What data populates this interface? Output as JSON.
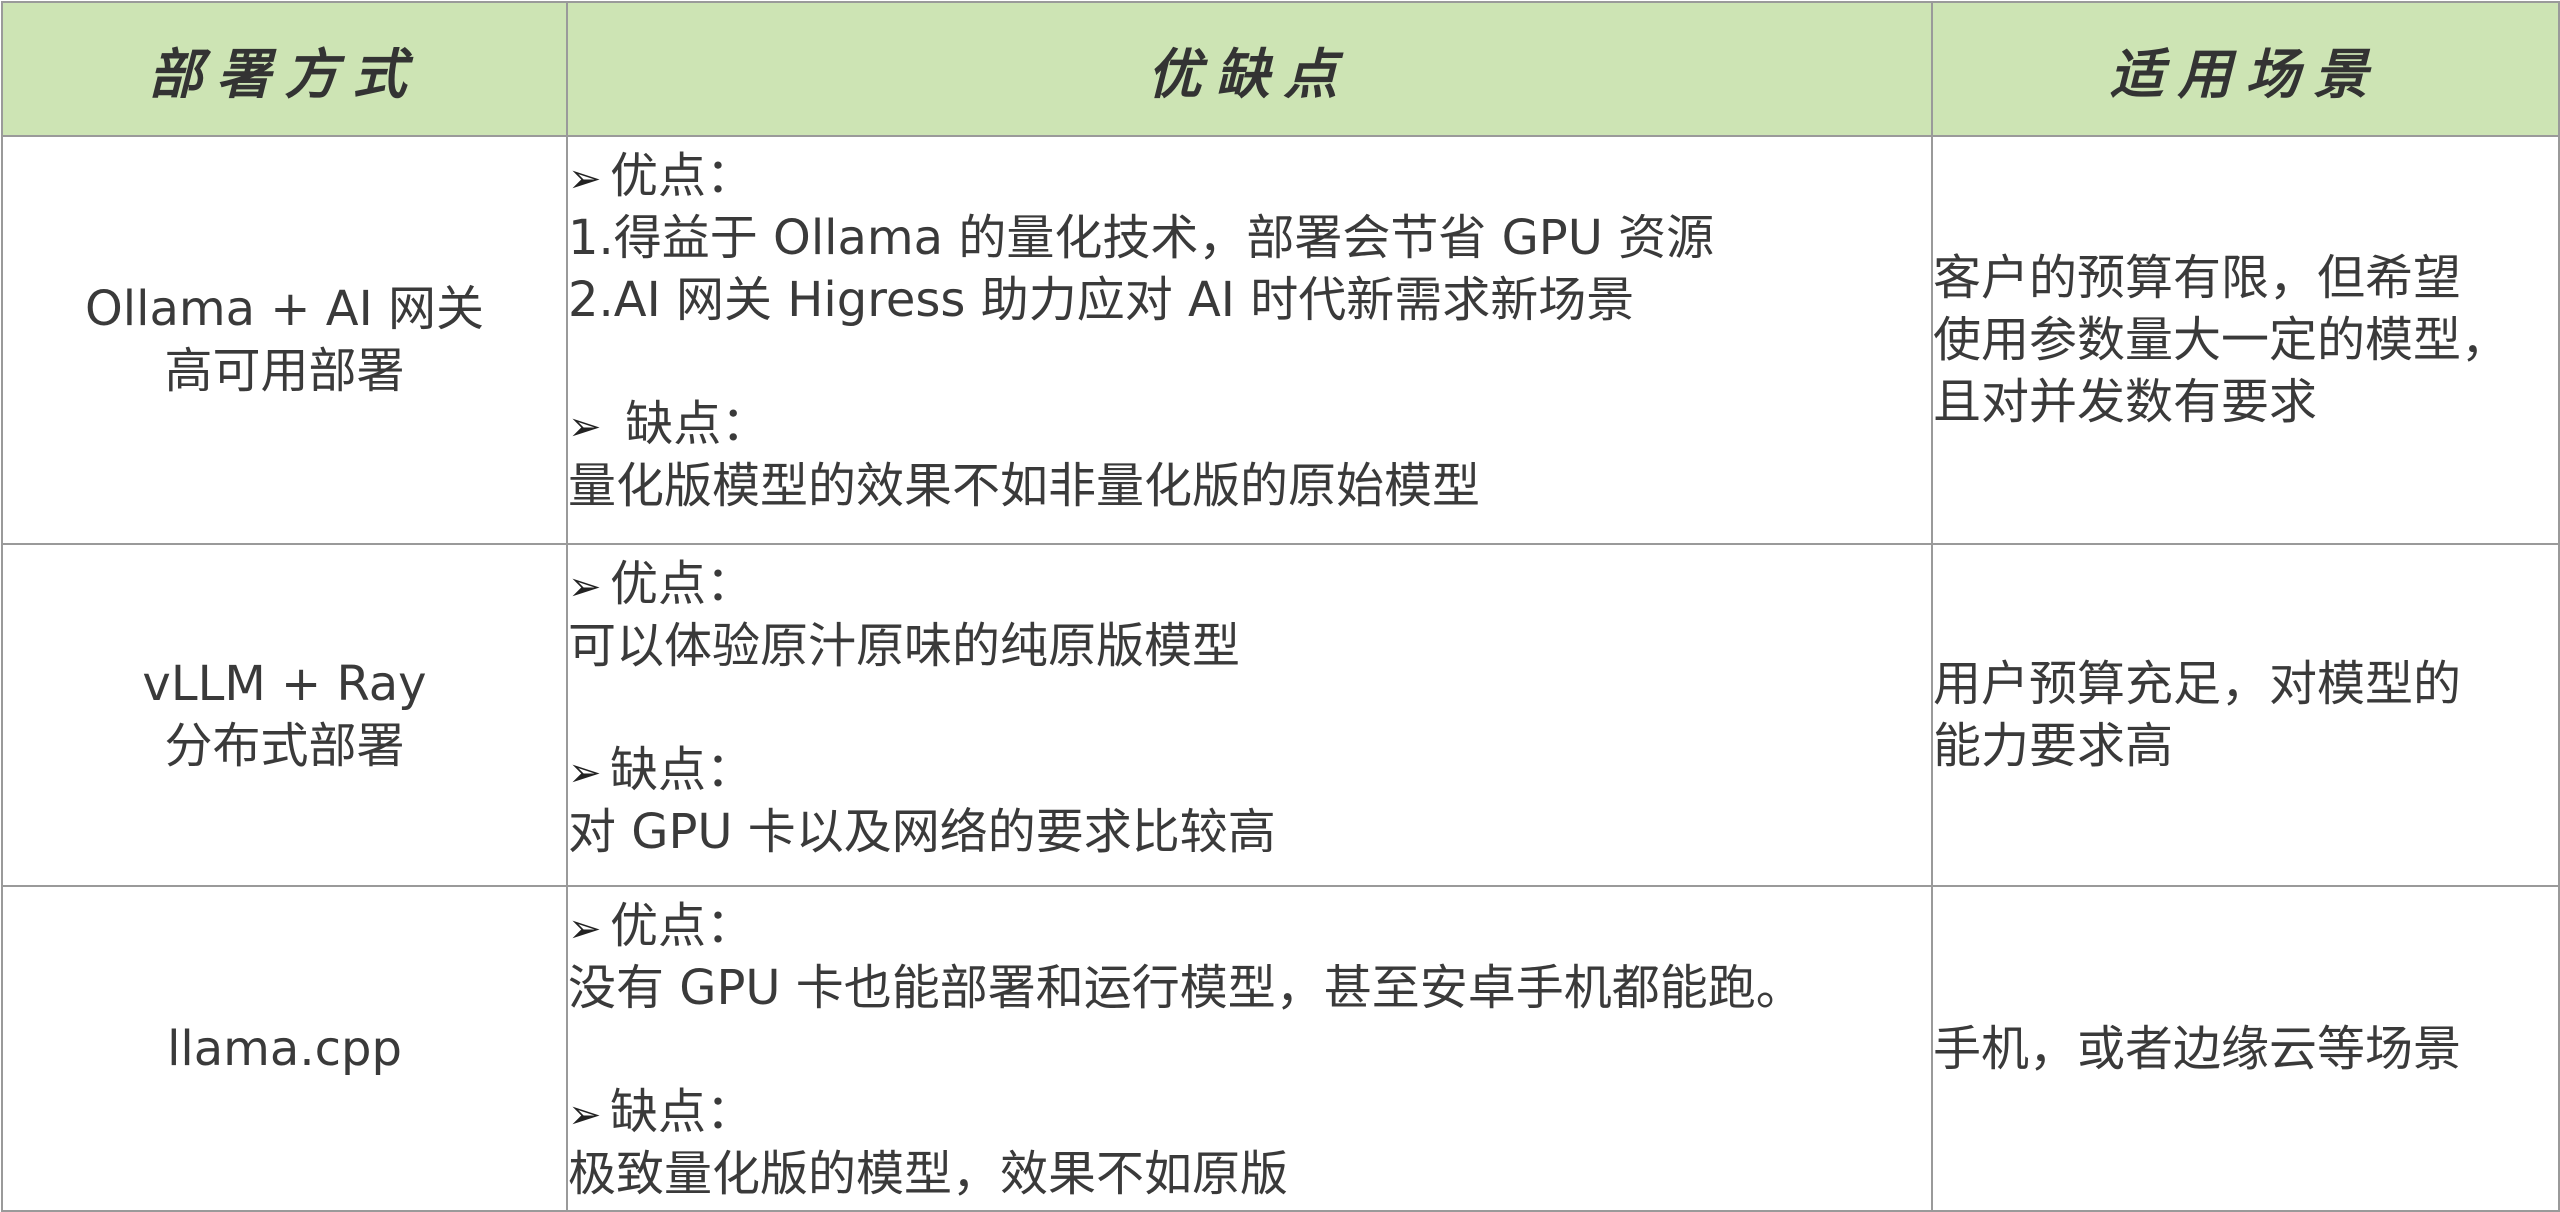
{
  "header": {
    "col1": "部署方式",
    "col2": "优缺点",
    "col3": "适用场景"
  },
  "rows": [
    {
      "mode_lines": [
        "Ollama + AI 网关",
        "高可用部署"
      ],
      "pros_label": "优点：",
      "pros": [
        "1.得益于 Ollama 的量化技术，部署会节省 GPU 资源",
        "2.AI 网关 Higress 助力应对 AI 时代新需求新场景"
      ],
      "cons_label": "缺点：",
      "cons": [
        "量化版模型的效果不如非量化版的原始模型"
      ],
      "scene_lines": [
        "客户的预算有限，但希望",
        "使用参数量大一定的模型，",
        "且对并发数有要求"
      ]
    },
    {
      "mode_lines": [
        "vLLM + Ray",
        "分布式部署"
      ],
      "pros_label": "优点：",
      "pros": [
        "可以体验原汁原味的纯原版模型"
      ],
      "cons_label": "缺点：",
      "cons": [
        "对 GPU 卡以及网络的要求比较高"
      ],
      "scene_lines": [
        "用户预算充足，对模型的",
        "能力要求高"
      ]
    },
    {
      "mode_lines": [
        "llama.cpp"
      ],
      "pros_label": "优点：",
      "pros": [
        "没有 GPU 卡也能部署和运行模型，甚至安卓手机都能跑。"
      ],
      "cons_label": "缺点：",
      "cons": [
        "极致量化版的模型，效果不如原版"
      ],
      "scene_lines": [
        "手机，或者边缘云等场景"
      ]
    }
  ],
  "icons": {
    "bullet": "arrowhead-bullet-icon",
    "bullet_glyph": "➢"
  }
}
